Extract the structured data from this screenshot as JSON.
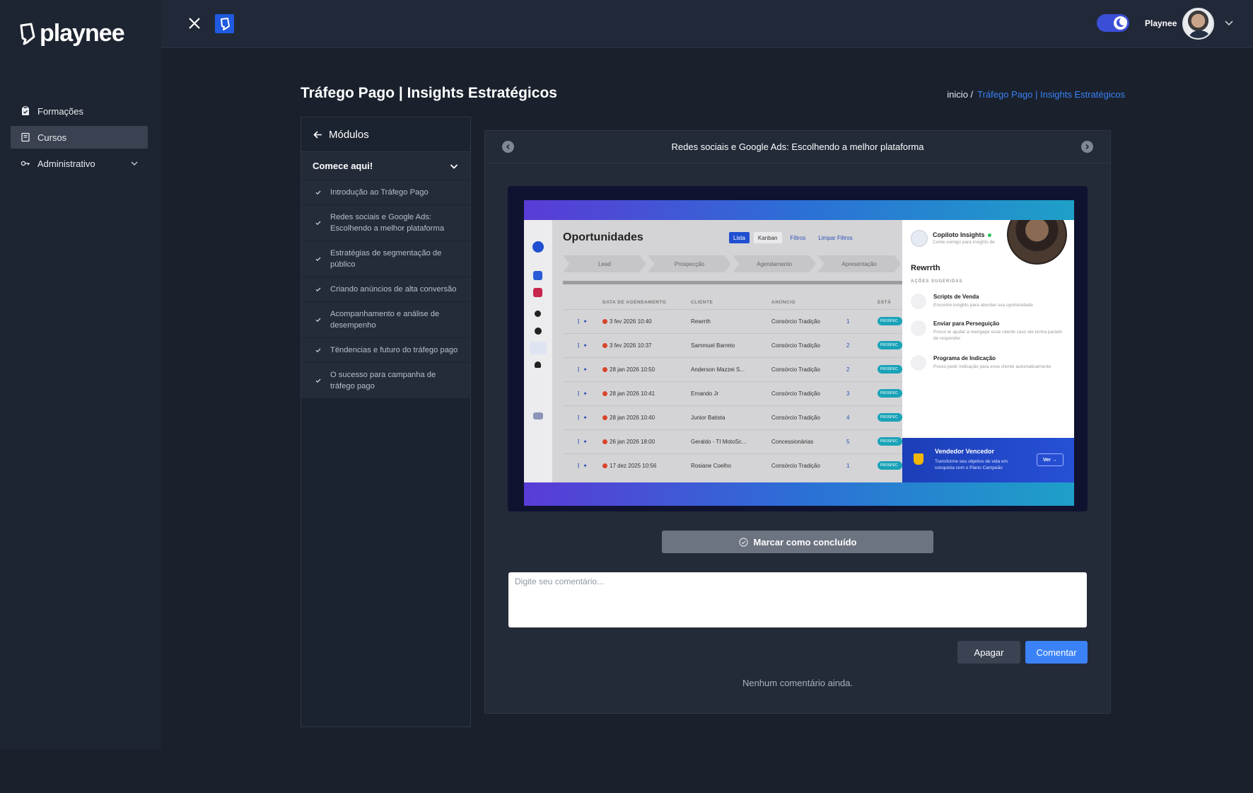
{
  "sidebar": {
    "logo_text": "playnee",
    "items": [
      {
        "label": "Formações",
        "icon": "clipboard-icon",
        "active": false
      },
      {
        "label": "Cursos",
        "icon": "book-icon",
        "active": true
      },
      {
        "label": "Administrativo",
        "icon": "key-icon",
        "active": false,
        "expandable": true
      }
    ]
  },
  "topbar": {
    "user_name": "Playnee",
    "theme_toggle": "dark-mode-on"
  },
  "page": {
    "title": "Tráfego Pago | Insights Estratégicos",
    "breadcrumb_home": "inicio /",
    "breadcrumb_current": "Tráfego Pago | Insights Estratégicos"
  },
  "modules": {
    "back_label": "Módulos",
    "section_title": "Comece aqui!",
    "lessons": [
      {
        "title": "Introdução ao Tráfego Pago"
      },
      {
        "title": "Redes sociais e Google Ads: Escolhendo a melhor plataforma"
      },
      {
        "title": "Estratégias de segmentação de público"
      },
      {
        "title": "Criando anúncios de alta conversão"
      },
      {
        "title": "Acompanhamento e análise de desempenho"
      },
      {
        "title": "Tëndencias e futuro do tráfego pago"
      },
      {
        "title": "O sucesso para campanha de tráfego pago"
      }
    ]
  },
  "lesson": {
    "title": "Redes sociais e Google Ads: Escolhendo a melhor plataforma",
    "mark_complete_label": "Marcar como concluído",
    "comment_placeholder": "Digite seu comentário...",
    "delete_label": "Apagar",
    "comment_label": "Comentar",
    "no_comments": "Nenhum comentário ainda."
  },
  "video": {
    "screen_title": "Oportunidades",
    "buttons": [
      "Lista",
      "Kanban",
      "Filtros",
      "Limpar Filtros"
    ],
    "stages": [
      "Lead",
      "Prospecção",
      "Agendamento",
      "Apresentação"
    ],
    "table_headers": [
      "DATA DE AGENDAMENTO",
      "CLIENTE",
      "ANÚNCIO",
      "ESTÁ"
    ],
    "rows": [
      {
        "date": "3 fev 2026 10:40",
        "client": "Rewrrth",
        "ad": "Consórcio Tradição",
        "count": "1"
      },
      {
        "date": "3 fev 2026 10:37",
        "client": "Sammuel Barreto",
        "ad": "Consórcio Tradição",
        "count": "2"
      },
      {
        "date": "28 jan 2026 10:50",
        "client": "Anderson Mazzei S...",
        "ad": "Consórcio Tradição",
        "count": "2"
      },
      {
        "date": "28 jan 2026 10:41",
        "client": "Ernando Jr",
        "ad": "Consórcio Tradição",
        "count": "3"
      },
      {
        "date": "28 jan 2026 10:40",
        "client": "Junior Batista",
        "ad": "Consórcio Tradição",
        "count": "4"
      },
      {
        "date": "26 jan 2026 18:00",
        "client": "Geraldo - TI MotoSc...",
        "ad": "Concessionárias",
        "count": "5"
      },
      {
        "date": "17 dez 2025 10:56",
        "client": "Rosiane Coelho",
        "ad": "Consórcio Tradição",
        "count": "1"
      }
    ],
    "status_pill": "PROSPEC",
    "copilot": {
      "title": "Copiloto Insights",
      "subtitle": "Conte comigo para insights de",
      "client_name": "Rewrrth",
      "section": "AÇÕES SUGERIDAS",
      "actions": [
        {
          "title": "Scripts de Venda",
          "desc": "Encontre insights para abordar sua oportunidade"
        },
        {
          "title": "Enviar para Perseguição",
          "desc": "Posso te ajudar a reengajar esse cliente caso ele tenha parado de responder"
        },
        {
          "title": "Programa de Indicação",
          "desc": "Posso pedir indicação para esse cliente automaticamente"
        }
      ],
      "banner_title": "Vendedor Vencedor",
      "banner_desc": "Transforme seu objetivo de vida em conquista com o Plano Campeão",
      "banner_button": "Ver →"
    }
  }
}
